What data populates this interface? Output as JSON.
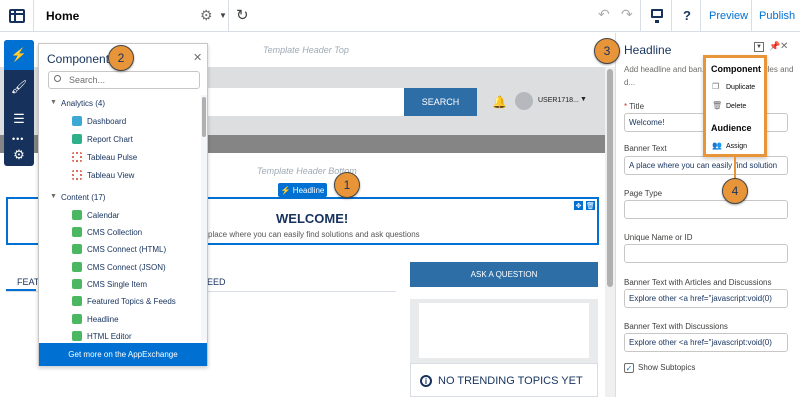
{
  "topbar": {
    "title": "Home",
    "preview_label": "Preview",
    "publish_label": "Publish"
  },
  "canvas": {
    "template_header_top": "Template Header Top",
    "template_header_bottom": "Template Header Bottom",
    "search_button": "SEARCH",
    "user_name": "USER1718...",
    "headline_badge": "Headline",
    "welcome_title": "WELCOME!",
    "welcome_subtitle": "place where you can easily find solutions and ask questions",
    "tab_featured": "FEAT",
    "tab_feed": "EED",
    "ask_button": "ASK A QUESTION",
    "trending_title": "NO TRENDING TOPICS YET"
  },
  "components_panel": {
    "title": "Components",
    "search_placeholder": "Search...",
    "footer": "Get more on the AppExchange",
    "sections": [
      {
        "label": "Analytics (4)",
        "items": [
          {
            "label": "Dashboard",
            "color": "#3ba8d6"
          },
          {
            "label": "Report Chart",
            "color": "#2eb08a"
          },
          {
            "label": "Tableau Pulse",
            "color": "#e06c5c"
          },
          {
            "label": "Tableau View",
            "color": "#e06c5c"
          }
        ]
      },
      {
        "label": "Content (17)",
        "items": [
          {
            "label": "Calendar",
            "color": "#4bb760"
          },
          {
            "label": "CMS Collection",
            "color": "#4bb760"
          },
          {
            "label": "CMS Connect (HTML)",
            "color": "#4bb760"
          },
          {
            "label": "CMS Connect (JSON)",
            "color": "#4bb760"
          },
          {
            "label": "CMS Single Item",
            "color": "#4bb760"
          },
          {
            "label": "Featured Topics & Feeds",
            "color": "#4bb760"
          },
          {
            "label": "Headline",
            "color": "#4bb760"
          },
          {
            "label": "HTML Editor",
            "color": "#4bb760"
          }
        ]
      }
    ]
  },
  "property_panel": {
    "title": "Headline",
    "description": "Add headline and ban... line links to articles and d...",
    "fields": [
      {
        "label": "Title",
        "required": true,
        "value": "Welcome!"
      },
      {
        "label": "Banner Text",
        "required": false,
        "value": "A place where you can easily find solution"
      },
      {
        "label": "Page Type",
        "required": false,
        "value": ""
      },
      {
        "label": "Unique Name or ID",
        "required": false,
        "value": ""
      },
      {
        "label": "Banner Text with Articles and Discussions",
        "required": false,
        "value": "Explore other <a href=\"javascript:void(0)"
      },
      {
        "label": "Banner Text with Discussions",
        "required": false,
        "value": "Explore other <a href=\"javascript:void(0)"
      }
    ],
    "checkbox_label": "Show Subtopics"
  },
  "menu": {
    "component_header": "Component",
    "duplicate": "Duplicate",
    "delete": "Delete",
    "audience_header": "Audience",
    "assign": "Assign"
  },
  "callouts": [
    "1",
    "2",
    "3",
    "4"
  ],
  "colors": {
    "accent": "#0070d2",
    "callout": "#e8953a",
    "navy": "#16325c"
  }
}
